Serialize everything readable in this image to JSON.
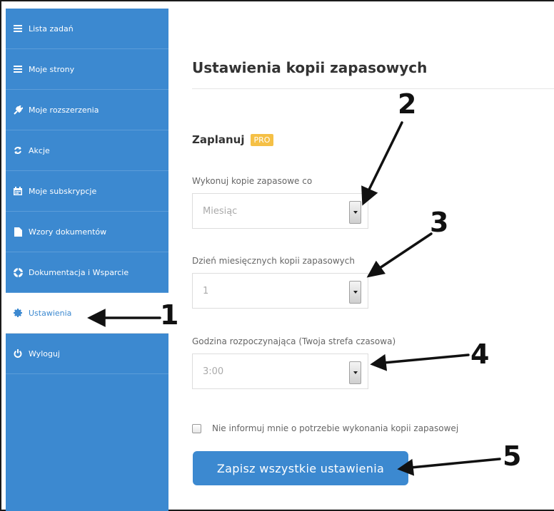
{
  "sidebar": {
    "items": [
      {
        "label": "Lista zadań",
        "icon": "list-icon"
      },
      {
        "label": "Moje strony",
        "icon": "list-icon"
      },
      {
        "label": "Moje rozszerzenia",
        "icon": "plug-icon"
      },
      {
        "label": "Akcje",
        "icon": "refresh-icon"
      },
      {
        "label": "Moje subskrypcje",
        "icon": "calendar-icon"
      },
      {
        "label": "Wzory dokumentów",
        "icon": "document-icon"
      },
      {
        "label": "Dokumentacja i Wsparcie",
        "icon": "lifebuoy-icon"
      },
      {
        "label": "Ustawienia",
        "icon": "gear-icon",
        "active": true
      },
      {
        "label": "Wyloguj",
        "icon": "power-icon"
      }
    ]
  },
  "main": {
    "title": "Ustawienia kopii zapasowych",
    "section_title": "Zaplanuj",
    "pro_badge": "PRO",
    "fields": {
      "frequency": {
        "label": "Wykonuj kopie zapasowe co",
        "value": "Miesiąc"
      },
      "day": {
        "label": "Dzień miesięcznych kopii zapasowych",
        "value": "1"
      },
      "hour": {
        "label": "Godzina rozpoczynająca (Twoja strefa czasowa)",
        "value": "3:00"
      }
    },
    "checkbox_label": "Nie informuj mnie o potrzebie wykonania kopii zapasowej",
    "save_label": "Zapisz wszystkie ustawienia"
  },
  "annotations": [
    "1",
    "2",
    "3",
    "4",
    "5"
  ],
  "colors": {
    "accent": "#3c89d0",
    "pro": "#f5c046"
  }
}
